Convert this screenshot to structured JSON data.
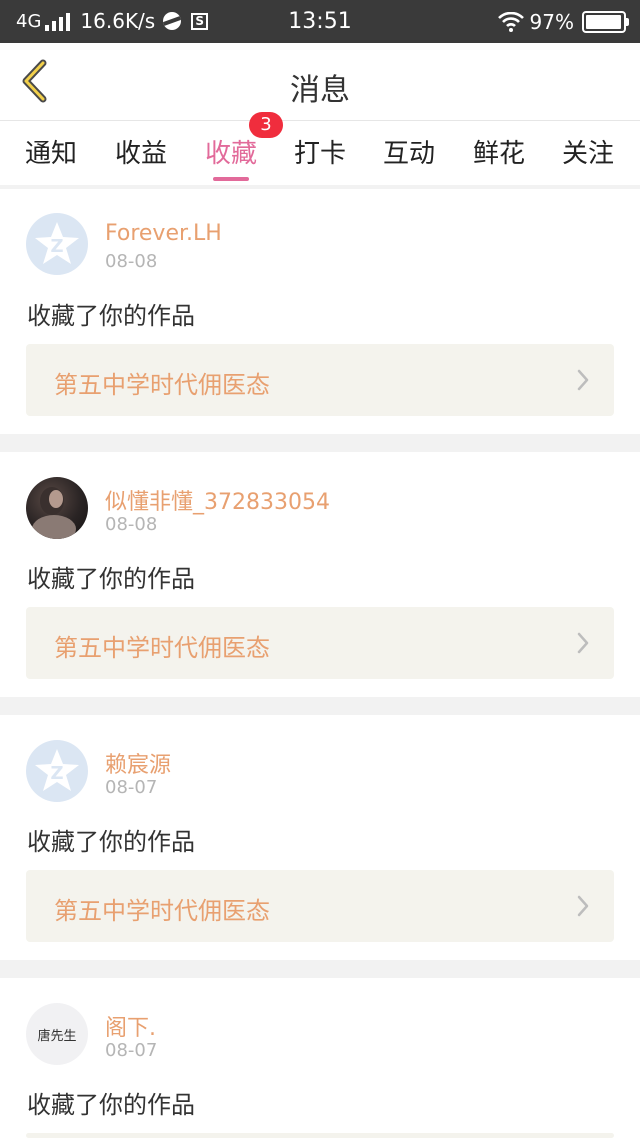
{
  "status_bar": {
    "network": "4G",
    "speed": "16.6K/s",
    "time": "13:51",
    "battery": "97%",
    "battery_level": 0.97
  },
  "header": {
    "title": "消息",
    "back_icon": "chevron-left-icon"
  },
  "tabs": [
    {
      "label": "通知"
    },
    {
      "label": "收益"
    },
    {
      "label": "收藏",
      "active": true,
      "badge": "3"
    },
    {
      "label": "打卡"
    },
    {
      "label": "互动"
    },
    {
      "label": "鲜花"
    },
    {
      "label": "关注"
    }
  ],
  "messages": [
    {
      "user": "Forever.LH",
      "date": "08-08",
      "action": "收藏了你的作品",
      "work": "第五中学时代佣医态",
      "avatar": "default-star"
    },
    {
      "user": "似懂非懂_372833054",
      "date": "08-08",
      "action": "收藏了你的作品",
      "work": "第五中学时代佣医态",
      "avatar": "photo"
    },
    {
      "user": "赖宸源",
      "date": "08-07",
      "action": "收藏了你的作品",
      "work": "第五中学时代佣医态",
      "avatar": "default-star"
    },
    {
      "user": "阁下.",
      "date": "08-07",
      "action": "收藏了你的作品",
      "avatar": "text",
      "avatar_text": "唐先生"
    }
  ],
  "colors": {
    "accent_pink": "#e26a9a",
    "username_orange": "#e8a070",
    "badge_red": "#f02d3d",
    "status_bar_bg": "#3a3a3a"
  }
}
